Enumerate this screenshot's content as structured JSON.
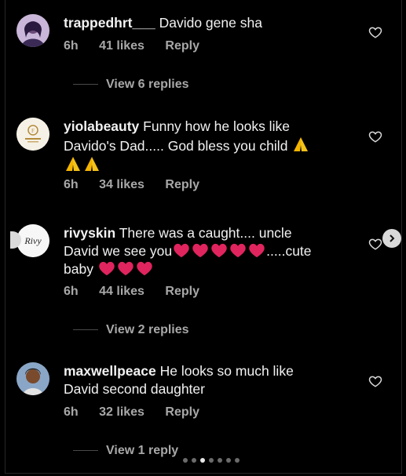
{
  "comments": [
    {
      "username": "trappedhrt___",
      "text": "Davido gene sha",
      "time": "6h",
      "likes": "41 likes",
      "reply": "Reply",
      "view_replies": "View 6 replies"
    },
    {
      "username": "yiolabeauty",
      "text_line1": "Funny how he looks like",
      "text_line2": "Davido's Dad..... God bless you child",
      "time": "6h",
      "likes": "34 likes",
      "reply": "Reply"
    },
    {
      "username": "rivyskin",
      "text_line1": "There was a caught.... uncle",
      "text_line2a": "David we see you",
      "text_line2b": ".....cute",
      "text_line3": "baby",
      "time": "6h",
      "likes": "44 likes",
      "reply": "Reply",
      "view_replies": "View 2 replies"
    },
    {
      "username": "maxwellpeace",
      "text_line1": "He looks so much like",
      "text_line2": "David second daughter",
      "time": "6h",
      "likes": "32 likes",
      "reply": "Reply",
      "view_replies": "View 1 reply"
    }
  ],
  "carousel": {
    "total": 7,
    "active_index": 2
  },
  "icons": {
    "like": "heart-icon",
    "next": "chevron-right-icon",
    "prayer": "folded-hands-emoji",
    "heart_emoji": "red-heart-emoji"
  },
  "colors": {
    "background": "#000000",
    "text": "#f2f2f2",
    "muted": "#a8a8a8",
    "heart_emoji": "#e0245e",
    "prayer_emoji": "#f4b400"
  }
}
